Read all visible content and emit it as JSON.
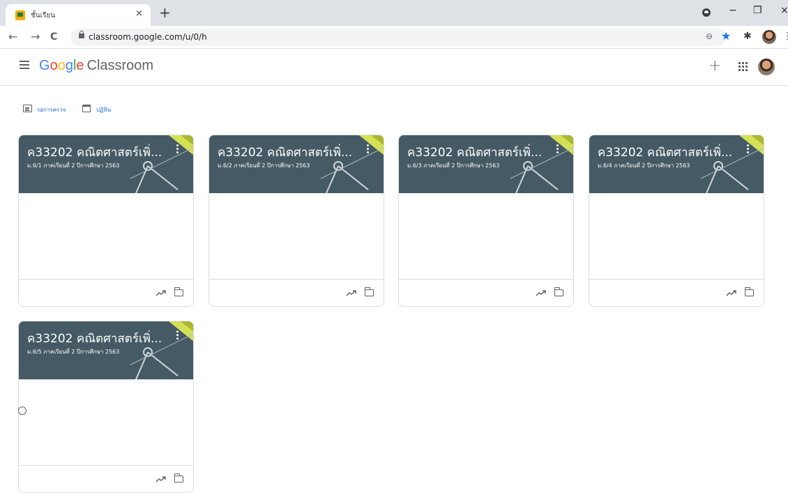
{
  "browser": {
    "tab_title": "ชั้นเรียน",
    "tab_close": "×",
    "new_tab": "+",
    "url": "classroom.google.com/u/0/h",
    "back": "←",
    "forward": "→",
    "reload": "C",
    "zoom": "⊖",
    "star": "★",
    "extensions": "✱",
    "menu": "⋮",
    "minimize": "−",
    "restore": "❐",
    "close": "×"
  },
  "app": {
    "brand_google": [
      "G",
      "o",
      "o",
      "g",
      "l",
      "e"
    ],
    "brand_product": "Classroom",
    "create": "+"
  },
  "subnav": {
    "todo_label": "รอการตรวจ",
    "calendar_label": "ปฏิทิน"
  },
  "colors": {
    "card_header": "#455a64",
    "accent_link": "#1967d2",
    "deco_yellow": "#d4e157"
  },
  "icons": [
    "hamburger-icon",
    "apps-grid-icon",
    "todo-icon",
    "calendar-icon",
    "trending-icon",
    "folder-icon",
    "more-vert-icon",
    "help-icon"
  ],
  "cards": [
    {
      "title": "ค33202 คณิตศาสตร์เพิ่...",
      "section": "ม.6/1 ภาคเรียนที่ 2 ปีการศึกษา 2563"
    },
    {
      "title": "ค33202 คณิตศาสตร์เพิ่...",
      "section": "ม.6/2 ภาคเรียนที่ 2 ปีการศึกษา 2563"
    },
    {
      "title": "ค33202 คณิตศาสตร์เพิ่...",
      "section": "ม.6/3 ภาคเรียนที่ 2 ปีการศึกษา 2563"
    },
    {
      "title": "ค33202 คณิตศาสตร์เพิ่...",
      "section": "ม.6/4 ภาคเรียนที่ 2 ปีการศึกษา 2563"
    },
    {
      "title": "ค33202 คณิตศาสตร์เพิ่...",
      "section": "ม.6/5 ภาคเรียนที่ 2 ปีการศึกษา 2563"
    }
  ]
}
